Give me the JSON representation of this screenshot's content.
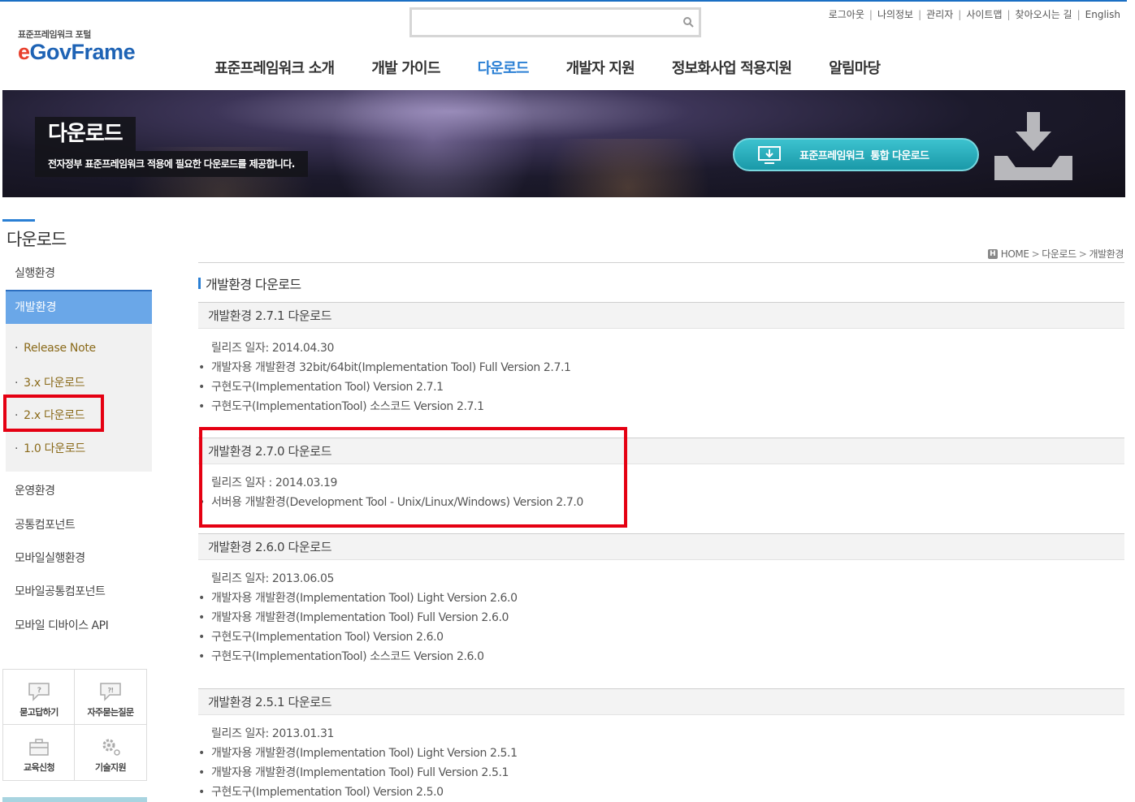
{
  "header": {
    "logo_sub": "표준프레임워크 포털",
    "logo_e": "e",
    "logo_rest": "GovFrame",
    "util_links": [
      "로그아웃",
      "나의정보",
      "관리자",
      "사이트맵",
      "찾아오시는 길",
      "English"
    ],
    "search_placeholder": "",
    "gnb": [
      "표준프레임워크 소개",
      "개발 가이드",
      "다운로드",
      "개발자 지원",
      "정보화사업 적용지원",
      "알림마당"
    ],
    "gnb_active_index": 2
  },
  "banner": {
    "title": "다운로드",
    "desc": "전자정부 표준프레임워크 적용에 필요한 다운로드를 제공합니다.",
    "button_label": "표준프레임워크  통합 다운로드"
  },
  "sidebar": {
    "title": "다운로드",
    "items": [
      "실행환경",
      "개발환경",
      "운영환경",
      "공통컴포넌트",
      "모바일실행환경",
      "모바일공통컴포넌트",
      "모바일 디바이스 API"
    ],
    "active": "개발환경",
    "sub_items": [
      "Release Note",
      "3.x 다운로드",
      "2.x 다운로드",
      "1.0 다운로드"
    ],
    "highlighted_sub_item": "2.x 다운로드",
    "quick_links": [
      "묻고답하기",
      "자주묻는질문",
      "교육신청",
      "기술지원"
    ]
  },
  "breadcrumb": [
    "HOME",
    "다운로드",
    "개발환경"
  ],
  "page_title": "개발환경 다운로드",
  "sections": [
    {
      "title": "개발환경 2.7.1 다운로드",
      "release": "릴리즈 일자: 2014.04.30",
      "links": [
        "개발자용 개발환경 32bit/64bit(Implementation Tool) Full Version 2.7.1",
        "구현도구(Implementation Tool) Version 2.7.1",
        "구현도구(ImplementationTool) 소스코드 Version 2.7.1"
      ]
    },
    {
      "title": "개발환경 2.7.0 다운로드",
      "release": "릴리즈 일자 : 2014.03.19",
      "links": [
        "서버용 개발환경(Development Tool - Unix/Linux/Windows) Version 2.7.0"
      ]
    },
    {
      "title": "개발환경 2.6.0 다운로드",
      "release": "릴리즈 일자: 2013.06.05",
      "links": [
        "개발자용 개발환경(Implementation Tool) Light Version 2.6.0",
        "개발자용 개발환경(Implementation Tool) Full Version 2.6.0",
        "구현도구(Implementation Tool) Version 2.6.0",
        "구현도구(ImplementationTool) 소스코드 Version 2.6.0"
      ]
    },
    {
      "title": "개발환경 2.5.1 다운로드",
      "release": "릴리즈 일자: 2013.01.31",
      "links": [
        "개발자용 개발환경(Implementation Tool) Light Version 2.5.1",
        "개발자용 개발환경(Implementation Tool) Full Version 2.5.1",
        "구현도구(Implementation Tool) Version 2.5.0"
      ]
    }
  ],
  "colors": {
    "accent_blue": "#2a7fd4",
    "highlight_red": "#e50012",
    "sidebar_active": "#6aa7e8",
    "banner_button": "#1fa6b4",
    "sub_item_text": "#8a6a1a"
  }
}
